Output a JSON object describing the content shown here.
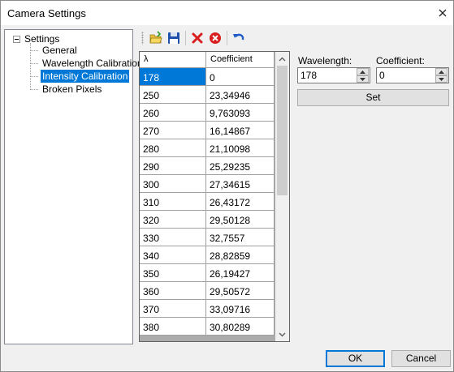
{
  "window": {
    "title": "Camera Settings"
  },
  "tree": {
    "root": "Settings",
    "items": [
      {
        "label": "General"
      },
      {
        "label": "Wavelength Calibration"
      },
      {
        "label": "Intensity Calibration",
        "selected": true
      },
      {
        "label": "Broken Pixels"
      }
    ]
  },
  "toolbar": {
    "buttons": [
      {
        "name": "open-icon"
      },
      {
        "name": "save-icon"
      },
      {
        "name": "delete-icon"
      },
      {
        "name": "clear-icon"
      },
      {
        "name": "undo-icon"
      }
    ]
  },
  "grid": {
    "columns": [
      "λ",
      "Coefficient"
    ],
    "rows": [
      [
        "178",
        "0"
      ],
      [
        "250",
        "23,34946"
      ],
      [
        "260",
        "9,763093"
      ],
      [
        "270",
        "16,14867"
      ],
      [
        "280",
        "21,10098"
      ],
      [
        "290",
        "25,29235"
      ],
      [
        "300",
        "27,34615"
      ],
      [
        "310",
        "26,43172"
      ],
      [
        "320",
        "29,50128"
      ],
      [
        "330",
        "32,7557"
      ],
      [
        "340",
        "28,82859"
      ],
      [
        "350",
        "26,19427"
      ],
      [
        "360",
        "29,50572"
      ],
      [
        "370",
        "33,09716"
      ],
      [
        "380",
        "30,80289"
      ]
    ],
    "selected_row": 0
  },
  "editor": {
    "wavelength_label": "Wavelength:",
    "wavelength_value": "178",
    "coefficient_label": "Coefficient:",
    "coefficient_value": "0",
    "set_label": "Set"
  },
  "footer": {
    "ok_label": "OK",
    "cancel_label": "Cancel"
  },
  "colors": {
    "accent": "#0078d7"
  }
}
